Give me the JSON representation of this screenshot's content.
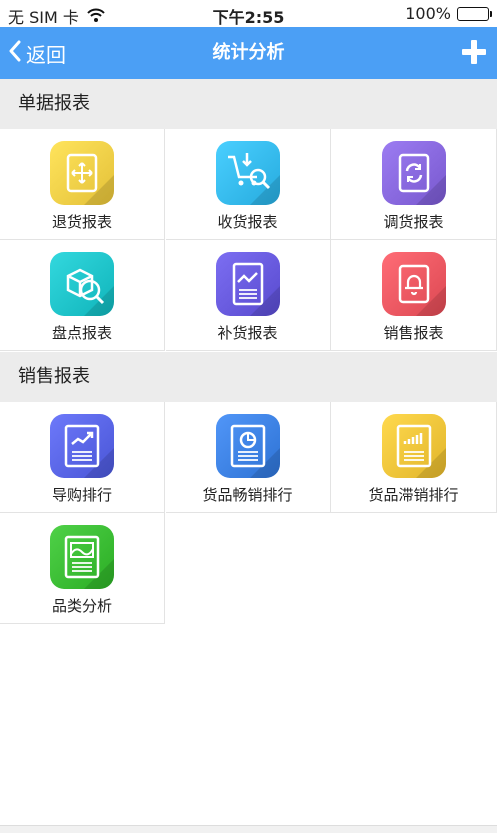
{
  "status": {
    "carrier": "无 SIM 卡",
    "time": "下午2:55",
    "battery": "100%",
    "battery_level": 1.0
  },
  "nav": {
    "back_label": "返回",
    "title": "统计分析",
    "add_icon": "plus-icon",
    "color": "#4b9ff5"
  },
  "sections": [
    {
      "title": "单据报表",
      "items": [
        {
          "label": "退货报表",
          "icon": "return-report-icon",
          "color": "#f5d24a"
        },
        {
          "label": "收货报表",
          "icon": "receive-report-icon",
          "color": "#38bdf0"
        },
        {
          "label": "调货报表",
          "icon": "transfer-report-icon",
          "color": "#8a6ae0"
        },
        {
          "label": "盘点报表",
          "icon": "inventory-report-icon",
          "color": "#21c6cc"
        },
        {
          "label": "补货报表",
          "icon": "replenish-report-icon",
          "color": "#6a5ce0"
        },
        {
          "label": "销售报表",
          "icon": "sales-report-icon",
          "color": "#ee5a64"
        }
      ]
    },
    {
      "title": "销售报表",
      "items": [
        {
          "label": "导购排行",
          "icon": "guide-ranking-icon",
          "color": "#5b67e8"
        },
        {
          "label": "货品畅销排行",
          "icon": "bestseller-ranking-icon",
          "color": "#3f84e6"
        },
        {
          "label": "货品滞销排行",
          "icon": "slow-seller-ranking-icon",
          "color": "#f3c73c"
        },
        {
          "label": "品类分析",
          "icon": "category-analysis-icon",
          "color": "#3dbf36"
        }
      ]
    }
  ]
}
